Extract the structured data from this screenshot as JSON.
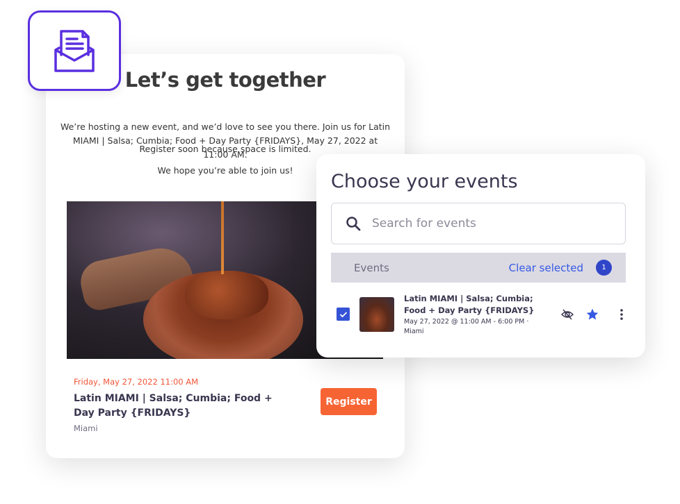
{
  "email": {
    "heading": "Let’s get together",
    "intro": "We’re hosting a new event, and we’d love to see you there. Join us for Latin MIAMI | Salsa; Cumbia; Food + Day Party {FRIDAYS}, May 27, 2022 at 11:00 AM.",
    "register_note": "Register soon because space is limited.",
    "closing": "We hope you’re able to join us!",
    "event_date": "Friday, May 27, 2022 11:00 AM",
    "event_title": "Latin MIAMI | Salsa; Cumbia; Food + Day Party {FRIDAYS}",
    "event_location": "Miami",
    "register_label": "Register",
    "badge_icon": "envelope-letter-icon"
  },
  "events_panel": {
    "title": "Choose your events",
    "search_placeholder": "Search for events",
    "header_label": "Events",
    "clear_label": "Clear selected",
    "selected_count": "1",
    "items": [
      {
        "title": "Latin MIAMI | Salsa; Cumbia; Food + Day Party {FRIDAYS}",
        "meta": "May 27, 2022 @ 11:00 AM - 6:00 PM · Miami",
        "checked": true,
        "starred": true
      }
    ]
  },
  "colors": {
    "accent_orange": "#f76433",
    "accent_blue": "#3659e3",
    "badge_purple": "#5a2fe0"
  }
}
